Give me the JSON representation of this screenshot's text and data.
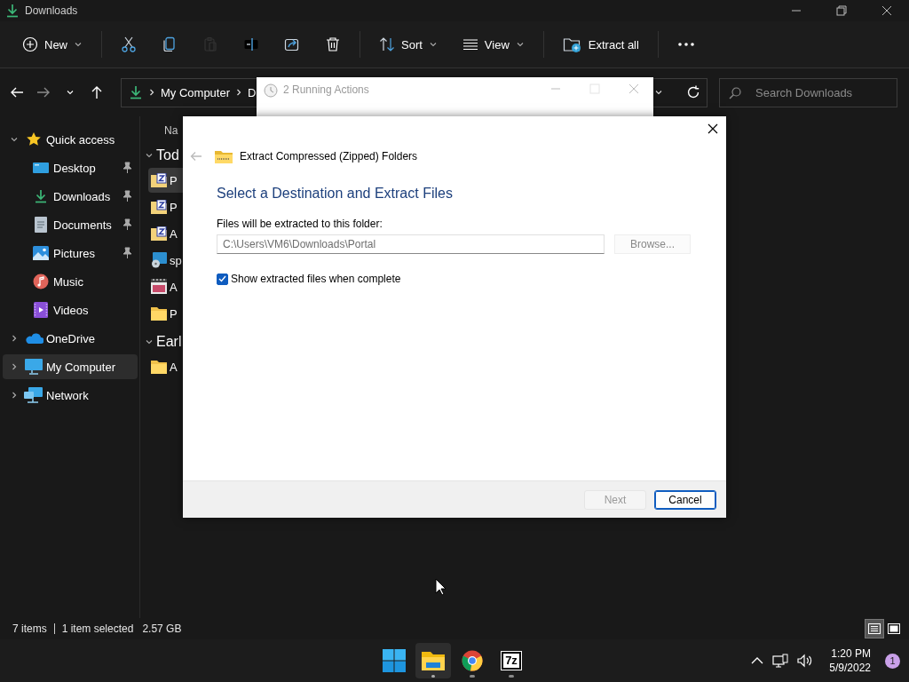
{
  "window": {
    "title": "Downloads"
  },
  "toolbar": {
    "groups": [
      [
        {
          "kind": "new",
          "label": "New",
          "dropdown": true,
          "disabled": false
        }
      ],
      [
        {
          "kind": "cut",
          "disabled": false
        },
        {
          "kind": "copy",
          "disabled": false
        },
        {
          "kind": "paste",
          "disabled": true
        },
        {
          "kind": "rename",
          "disabled": false
        },
        {
          "kind": "share",
          "disabled": false
        },
        {
          "kind": "delete",
          "disabled": false
        }
      ],
      [
        {
          "kind": "sort",
          "label": "Sort",
          "dropdown": true,
          "disabled": false
        },
        {
          "kind": "view",
          "label": "View",
          "dropdown": true,
          "disabled": false
        }
      ],
      [
        {
          "kind": "extract",
          "label": "Extract all",
          "disabled": false
        }
      ],
      [
        {
          "kind": "more",
          "disabled": false
        }
      ]
    ]
  },
  "nav": [
    {
      "kind": "back",
      "disabled": false
    },
    {
      "kind": "forward",
      "disabled": true
    },
    {
      "kind": "recent",
      "disabled": false
    },
    {
      "kind": "up",
      "disabled": false
    }
  ],
  "address": {
    "crumbs": [
      "My Computer",
      "D"
    ]
  },
  "search": {
    "placeholder": "Search Downloads"
  },
  "sidebar": {
    "items": [
      {
        "kind": "star",
        "label": "Quick access",
        "expanded": true,
        "selected": false,
        "children": [
          {
            "kind": "desktop",
            "label": "Desktop",
            "pinned": true,
            "selected": false
          },
          {
            "kind": "download",
            "label": "Downloads",
            "pinned": true,
            "selected": false
          },
          {
            "kind": "document",
            "label": "Documents",
            "pinned": true,
            "selected": false
          },
          {
            "kind": "pictures",
            "label": "Pictures",
            "pinned": true,
            "selected": false
          },
          {
            "kind": "music",
            "label": "Music",
            "pinned": false,
            "selected": false
          },
          {
            "kind": "videos",
            "label": "Videos",
            "pinned": false,
            "selected": false
          }
        ]
      },
      {
        "kind": "cloud",
        "label": "OneDrive",
        "expanded": false,
        "selected": false
      },
      {
        "kind": "computer",
        "label": "My Computer",
        "expanded": false,
        "selected": true
      },
      {
        "kind": "network",
        "label": "Network",
        "expanded": false,
        "selected": false
      }
    ]
  },
  "file_list": {
    "column_1": "Na",
    "groups": [
      {
        "label": "Tod",
        "expanded": true,
        "rows": [
          {
            "kind": "zip",
            "name": "P",
            "selected": true
          },
          {
            "kind": "zip",
            "name": "P",
            "selected": false
          },
          {
            "kind": "zip",
            "name": "A",
            "selected": false
          },
          {
            "kind": "disc",
            "name": "sp",
            "selected": false
          },
          {
            "kind": "video",
            "name": "A",
            "selected": false
          },
          {
            "kind": "folder",
            "name": "P",
            "selected": false
          }
        ]
      },
      {
        "label": "Earl",
        "expanded": true,
        "rows": [
          {
            "kind": "folder",
            "name": "A",
            "selected": false
          }
        ]
      }
    ]
  },
  "running_actions": {
    "title": "2 Running Actions"
  },
  "dialog": {
    "title": "Extract Compressed (Zipped) Folders",
    "back_disabled": true,
    "heading": "Select a Destination and Extract Files",
    "field_label": "Files will be extracted to this folder:",
    "path": {
      "value": "C:\\Users\\VM6\\Downloads\\Portal"
    },
    "browse": {
      "label": "Browse...",
      "disabled": true
    },
    "checkbox": {
      "label": "Show extracted files when complete",
      "checked": true
    },
    "buttons": [
      {
        "label": "Next",
        "disabled": true,
        "default": false
      },
      {
        "label": "Cancel",
        "disabled": false,
        "default": true
      }
    ]
  },
  "status_bar": {
    "item_count": "7 items",
    "selection": "1 item selected",
    "size": "2.57 GB",
    "views": [
      {
        "kind": "details",
        "selected": true
      },
      {
        "kind": "tiles",
        "selected": false
      }
    ]
  },
  "taskbar": {
    "apps": [
      {
        "kind": "start",
        "active": false,
        "running": false
      },
      {
        "kind": "explorer",
        "active": true,
        "running": true
      },
      {
        "kind": "chrome",
        "active": false,
        "running": true
      },
      {
        "kind": "sevenzip",
        "label": "7z",
        "active": false,
        "running": true
      }
    ],
    "time": "1:20 PM",
    "date": "5/9/2022",
    "notification_count": "1"
  }
}
